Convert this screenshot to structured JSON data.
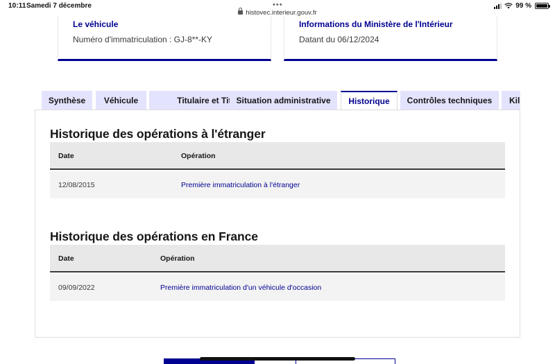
{
  "status_bar": {
    "time": "10:11",
    "date": "Samedi 7 décembre",
    "battery": "99 %"
  },
  "browser": {
    "url": "histovec.interieur.gouv.fr"
  },
  "cards": {
    "vehicle": {
      "title": "Le véhicule",
      "text": "Numéro d'immatriculation : GJ-8**-KY"
    },
    "ministry": {
      "title": "Informations du Ministère de l'Intérieur",
      "text": "Datant du 06/12/2024"
    }
  },
  "tabs": [
    {
      "label": "Synthèse"
    },
    {
      "label": "Véhicule"
    },
    {
      "label": "Titulaire et Titre"
    },
    {
      "label": "Situation administrative"
    },
    {
      "label": "Historique",
      "active": true
    },
    {
      "label": "Contrôles techniques"
    },
    {
      "label": "Kilo"
    }
  ],
  "history_abroad": {
    "title": "Historique des opérations à l'étranger",
    "columns": {
      "date": "Date",
      "operation": "Opération"
    },
    "rows": [
      {
        "date": "12/08/2015",
        "operation": "Première immatriculation à l'étranger"
      }
    ]
  },
  "history_france": {
    "title": "Historique des opérations en France",
    "columns": {
      "date": "Date",
      "operation": "Opération"
    },
    "rows": [
      {
        "date": "09/09/2022",
        "operation": "Première immatriculation d'un véhicule d'occasion"
      }
    ]
  },
  "colors": {
    "accent": "#000091",
    "tab_background": "#e3e3fd",
    "table_header": "#e8e8e8",
    "table_row": "#f3f3f3"
  }
}
